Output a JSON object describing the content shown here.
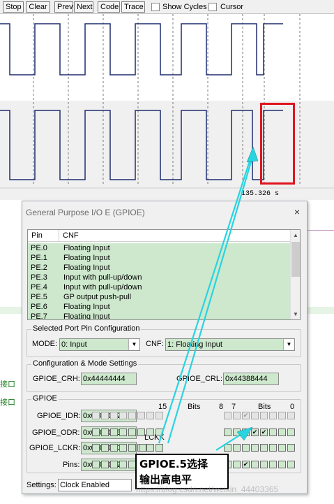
{
  "toolbar": {
    "buttons": [
      "Stop",
      "Clear",
      "Prev",
      "Next",
      "Code",
      "Trace"
    ],
    "checkboxes": [
      {
        "label": "Show Cycles",
        "checked": false
      },
      {
        "label": "Cursor",
        "checked": false
      }
    ]
  },
  "waveform": {
    "time_readout": "135.326  s"
  },
  "side_text": [
    "接口",
    "接口"
  ],
  "dialog": {
    "title": "General Purpose I/O E (GPIOE)",
    "close_glyph": "×",
    "pin_list": {
      "headers": [
        "Pin",
        "CNF"
      ],
      "rows": [
        {
          "pin": "PE.0",
          "cnf": "Floating Input"
        },
        {
          "pin": "PE.1",
          "cnf": "Floating Input"
        },
        {
          "pin": "PE.2",
          "cnf": "Floating Input"
        },
        {
          "pin": "PE.3",
          "cnf": "Input with pull-up/down"
        },
        {
          "pin": "PE.4",
          "cnf": "Input with pull-up/down"
        },
        {
          "pin": "PE.5",
          "cnf": "GP output push-pull"
        },
        {
          "pin": "PE.6",
          "cnf": "Floating Input"
        },
        {
          "pin": "PE.7",
          "cnf": "Floating Input"
        }
      ]
    },
    "selected_pin": {
      "title": "Selected Port Pin Configuration",
      "mode_label": "MODE:",
      "mode_value": "0: Input",
      "cnf_label": "CNF:",
      "cnf_value": "1: Floating Input"
    },
    "config": {
      "title": "Configuration & Mode Settings",
      "crh_label": "GPIOE_CRH:",
      "crh_value": "0x44444444",
      "crl_label": "GPIOE_CRL:",
      "crl_value": "0x44388444"
    },
    "gpio": {
      "title": "GPIOE",
      "bits_high_label": "15",
      "bits_high_mid": "Bits",
      "bits_high_low": "8",
      "bits_low_high": "7",
      "bits_low_mid": "Bits",
      "bits_low_low": "0",
      "lckk_label": "LCKK",
      "idr_label": "GPIOE_IDR:",
      "idr_value": "0x00000020",
      "odr_label": "GPIOE_ODR:",
      "odr_value": "0x00000038",
      "lckr_label": "GPIOE_LCKR:",
      "lckr_value": "0x00000000",
      "pins_label": "Pins:",
      "pins_value": "0x00000020"
    },
    "settings_label": "Settings:",
    "settings_value": "Clock Enabled"
  },
  "annotation": {
    "line1": "GPIOE.5选择",
    "line2": "输出高电平"
  },
  "watermark": "https://blog.csdn.net/weixin_44403365",
  "colors": {
    "field_green": "#cde8cd",
    "highlight_red": "#e0141e",
    "arrow_cyan": "#28d4e0",
    "waveform_navy": "#1f2d6e"
  }
}
